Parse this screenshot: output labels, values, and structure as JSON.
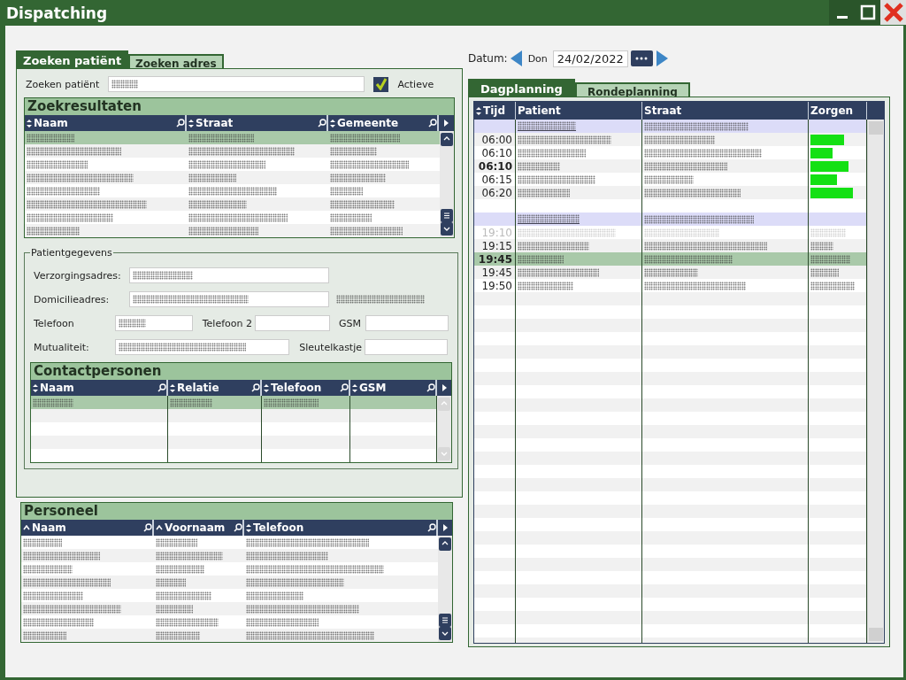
{
  "window": {
    "title": "Dispatching"
  },
  "left_tabs": [
    {
      "label": "Zoeken patiënt",
      "selected": true
    },
    {
      "label": "Zoeken adres",
      "selected": false
    }
  ],
  "search": {
    "label": "Zoeken patiënt",
    "filled": true,
    "active_label": "Actieve",
    "active_checked": true
  },
  "search_results": {
    "title": "Zoekresultaten",
    "columns": [
      {
        "label": "Naam",
        "kind": "toggle"
      },
      {
        "label": "Straat",
        "kind": "toggle"
      },
      {
        "label": "Gemeente",
        "kind": "toggle"
      }
    ],
    "rows": [
      {
        "selected": true
      },
      {
        "selected": false
      },
      {
        "selected": false
      },
      {
        "selected": false
      },
      {
        "selected": false
      },
      {
        "selected": false
      },
      {
        "selected": false
      },
      {
        "selected": false
      }
    ]
  },
  "patient_details": {
    "legend": "Patientgegevens",
    "fields": [
      {
        "label": "Verzorgingsadres:",
        "filled": true
      },
      {
        "label": "Domicilieadres:",
        "filled": true,
        "note": true
      },
      {
        "label": "Telefoon",
        "filled": true
      },
      {
        "label": "Telefoon 2",
        "filled": false
      },
      {
        "label": "GSM",
        "filled": false
      },
      {
        "label": "Mutualiteit:",
        "filled": true
      },
      {
        "label": "Sleutelkastje",
        "filled": false
      }
    ]
  },
  "contacts": {
    "title": "Contactpersonen",
    "columns": [
      {
        "label": "Naam",
        "kind": "toggle"
      },
      {
        "label": "Relatie",
        "kind": "toggle"
      },
      {
        "label": "Telefoon",
        "kind": "toggle"
      },
      {
        "label": "GSM",
        "kind": "toggle"
      }
    ],
    "rows": [
      {
        "selected": true,
        "filled": true
      },
      {
        "selected": false,
        "filled": false
      },
      {
        "selected": false,
        "filled": false
      },
      {
        "selected": false,
        "filled": false
      },
      {
        "selected": false,
        "filled": false
      }
    ]
  },
  "staff": {
    "title": "Personeel",
    "columns": [
      {
        "label": "Naam",
        "kind": "asc"
      },
      {
        "label": "Voornaam",
        "kind": "asc"
      },
      {
        "label": "Telefoon",
        "kind": "toggle"
      }
    ],
    "rows": [
      {
        "selected": false
      },
      {
        "selected": false
      },
      {
        "selected": false
      },
      {
        "selected": false
      },
      {
        "selected": false
      },
      {
        "selected": false
      },
      {
        "selected": false
      },
      {
        "selected": false
      }
    ]
  },
  "date": {
    "label": "Datum:",
    "weekday": "Don",
    "value": "24/02/2022"
  },
  "right_tabs": [
    {
      "label": "Dagplanning",
      "selected": true
    },
    {
      "label": "Rondeplanning",
      "selected": false
    }
  ],
  "planning": {
    "columns": [
      {
        "label": "Tijd",
        "kind": "toggle"
      },
      {
        "label": "Patient",
        "kind": "plain"
      },
      {
        "label": "Straat",
        "kind": "plain"
      },
      {
        "label": "Zorgen",
        "kind": "plain"
      }
    ],
    "rows": [
      {
        "kind": "group"
      },
      {
        "kind": "visit",
        "time": "06:00",
        "bold": false,
        "disabled": false,
        "selected": false,
        "care_done": true
      },
      {
        "kind": "visit",
        "time": "06:10",
        "bold": false,
        "disabled": false,
        "selected": false,
        "care_done": true
      },
      {
        "kind": "visit",
        "time": "06:10",
        "bold": true,
        "disabled": false,
        "selected": false,
        "care_done": true
      },
      {
        "kind": "visit",
        "time": "06:15",
        "bold": false,
        "disabled": false,
        "selected": false,
        "care_done": true
      },
      {
        "kind": "visit",
        "time": "06:20",
        "bold": false,
        "disabled": false,
        "selected": false,
        "care_done": true
      },
      {
        "kind": "blank"
      },
      {
        "kind": "group"
      },
      {
        "kind": "visit",
        "time": "19:10",
        "bold": false,
        "disabled": true,
        "selected": false,
        "care_done": false
      },
      {
        "kind": "visit",
        "time": "19:15",
        "bold": false,
        "disabled": false,
        "selected": false,
        "care_done": false
      },
      {
        "kind": "visit",
        "time": "19:45",
        "bold": true,
        "disabled": false,
        "selected": true,
        "care_done": false
      },
      {
        "kind": "visit",
        "time": "19:45",
        "bold": false,
        "disabled": false,
        "selected": false,
        "care_done": false
      },
      {
        "kind": "visit",
        "time": "19:50",
        "bold": false,
        "disabled": false,
        "selected": false,
        "care_done": false
      }
    ]
  }
}
